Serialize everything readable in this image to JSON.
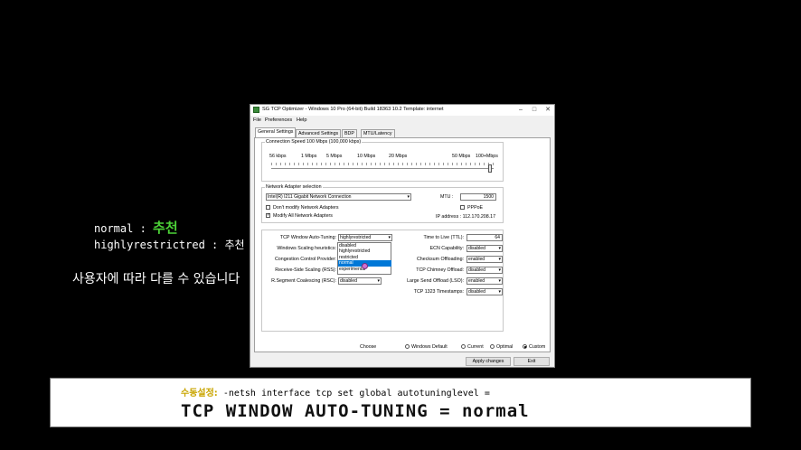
{
  "annotations": {
    "line1_prefix": "normal : ",
    "line1_highlight": "추천",
    "line2": "highlyrestrictred : 추천",
    "line3": "사용자에 따라 다를 수 있습니다"
  },
  "window": {
    "title": "SG TCP Optimizer - Windows 10 Pro (64-bit) Build 18363 10.2  Template: internet",
    "controls": [
      "–",
      "□",
      "✕"
    ],
    "menu": [
      "File",
      "Preferences",
      "Help"
    ],
    "tabs": [
      "General Settings",
      "Advanced Settings",
      "BDP",
      "MTU/Latency"
    ],
    "connection_speed": {
      "label": "Connection Speed  100 Mbps (100,000 kbps)",
      "ticks": [
        "56 kbps",
        "1 Mbps",
        "5 Mbps",
        "10 Mbps",
        "20 Mbps",
        "50 Mbps",
        "100+Mbps"
      ]
    },
    "adapter": {
      "label": "Network Adapter selection",
      "selected": "Intel(R) I211 Gigabit Network Connection",
      "mtu_label": "MTU :",
      "mtu_value": "1500",
      "dont_modify": "Don't modify Network Adapters",
      "modify_all": "Modify All Network Adapters",
      "pppoe": "PPPoE",
      "ip_label": "IP address : 112.170.208.17"
    },
    "left_settings": {
      "labels": [
        "TCP Window Auto-Tuning:",
        "Windows Scaling heuristics:",
        "Congestion Control Provider:",
        "Receive-Side Scaling (RSS):",
        "R.Segment Coalescing (RSC):"
      ],
      "autotuning_value": "highlyrestricted",
      "rsc_value": "disabled",
      "dropdown_options": [
        "disabled",
        "highlyrestricted",
        "restricted",
        "normal",
        "experimental"
      ],
      "dropdown_selected": "normal"
    },
    "right_settings": {
      "labels": [
        "Time to Live (TTL):",
        "ECN Capability:",
        "Checksum Offloading:",
        "TCP Chimney Offload:",
        "Large Send Offload (LSO):",
        "TCP 1323 Timestamps:"
      ],
      "values": [
        "64",
        "disabled",
        "enabled",
        "disabled",
        "enabled",
        "disabled"
      ]
    },
    "choose": {
      "label": "Choose",
      "options": [
        "Windows Default",
        "Current",
        "Optimal",
        "Custom"
      ],
      "selected": "Custom"
    },
    "buttons": {
      "apply": "Apply changes",
      "exit": "Exit"
    }
  },
  "banner": {
    "sub_prefix": "수동설정:",
    "sub_text": " -netsh interface tcp set global autotuninglevel =",
    "main": "TCP WINDOW AUTO-TUNING = normal"
  }
}
